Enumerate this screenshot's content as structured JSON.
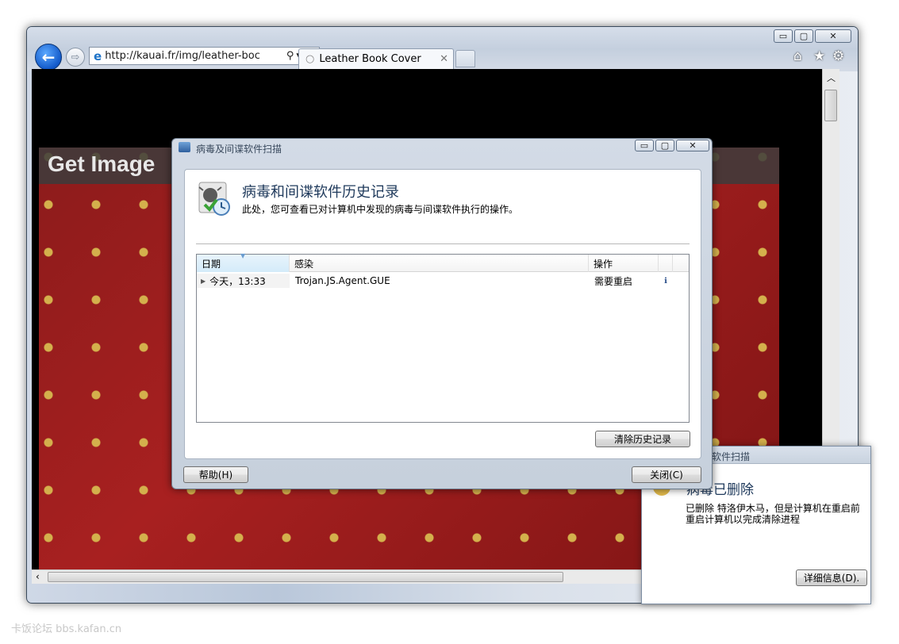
{
  "browser": {
    "address_url": "http://kauai.fr/img/leather-boc",
    "tab_title": "Leather Book Cover",
    "window_buttons": [
      "▭",
      "▢",
      "✕"
    ],
    "icons": [
      "back-icon",
      "forward-icon",
      "ie-logo-icon",
      "search-icon",
      "dropdown-icon",
      "stop-icon",
      "loading-icon",
      "tab-close-icon",
      "home-icon",
      "favorites-icon",
      "gear-icon"
    ]
  },
  "page": {
    "banner_text": "Get Image"
  },
  "dialog": {
    "title": "病毒及间谍软件扫描",
    "heading": "病毒和间谍软件历史记录",
    "description": "此处，您可查看已对计算机中发现的病毒与间谍软件执行的操作。",
    "columns": [
      "日期",
      "感染",
      "操作"
    ],
    "rows": [
      {
        "date": "今天，13:33",
        "infection": "Trojan.JS.Agent.GUE",
        "action": "需要重启"
      }
    ],
    "clear_button": "清除历史记录",
    "help_button": "帮助(H)",
    "close_button": "关闭(C)"
  },
  "notification": {
    "title": "软件扫描",
    "heading": "病毒已删除",
    "line1": "已删除 特洛伊木马，但是计算机在重启前",
    "line2": "重启计算机以完成清除进程",
    "details_button": "详细信息(D)."
  },
  "watermark": "卡饭论坛 bbs.kafan.cn",
  "colors": {
    "accent": "#1259c9",
    "heading": "#1e395b",
    "leather_red": "#8c1b1b",
    "gold": "#d4b04c"
  }
}
